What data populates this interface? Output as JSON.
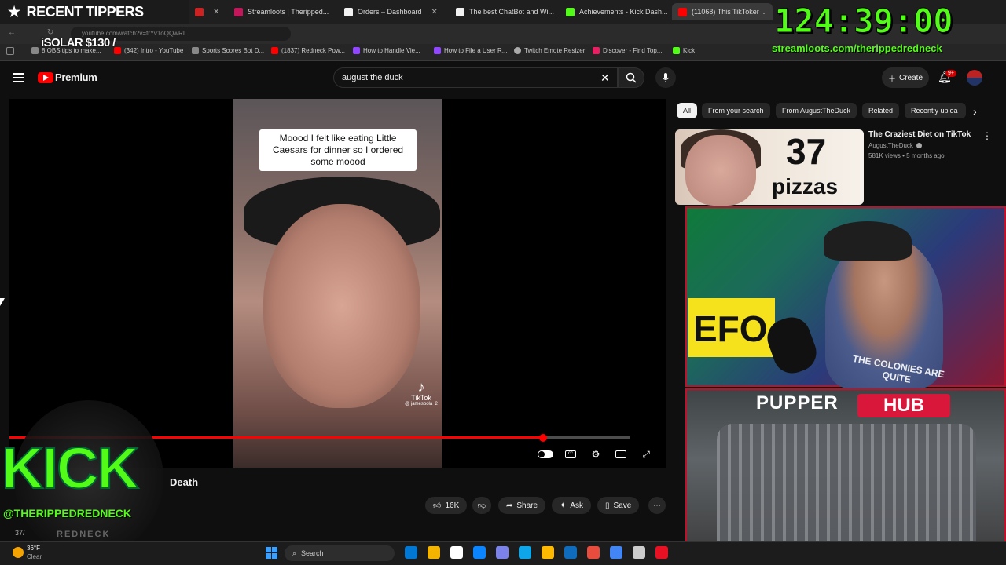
{
  "browser": {
    "tabs": [
      {
        "label": "",
        "color": "#cc2222"
      },
      {
        "label": "Streamloots | Theripped...",
        "color": "#c2185b"
      },
      {
        "label": "Orders – Dashboard",
        "color": "#f1f1f1"
      },
      {
        "label": "The best ChatBot and Wi...",
        "color": "#f1f1f1"
      },
      {
        "label": "Achievements - Kick Dash...",
        "color": "#53fc18"
      },
      {
        "label": "(11068) This TikToker ...",
        "color": "#ff0000"
      }
    ],
    "url": "youtube.com/watch?v=frYv1oQQwRI",
    "bookmarks": [
      {
        "label": "8 OBS tips to make...",
        "color": "#888888"
      },
      {
        "label": "(342) Intro - YouTube",
        "color": "#ff0000"
      },
      {
        "label": "Sports Scores Bot D...",
        "color": "#888888"
      },
      {
        "label": "(1837) Redneck Pow...",
        "color": "#ff0000"
      },
      {
        "label": "How to Handle Vie...",
        "color": "#9146ff"
      },
      {
        "label": "How to File a User R...",
        "color": "#9146ff"
      },
      {
        "label": "Twitch Emote Resizer",
        "color": "#aaaaaa"
      },
      {
        "label": "Discover - Find Top...",
        "color": "#e91e63"
      },
      {
        "label": "Kick",
        "color": "#53fc18"
      }
    ]
  },
  "youtube": {
    "logo": "Premium",
    "search_value": "august the duck",
    "create_label": "Create",
    "notif_count": "9+",
    "chips": [
      "All",
      "From your search",
      "From AugustTheDuck",
      "Related",
      "Recently uploa"
    ],
    "video": {
      "caption": "Moood I felt like eating Little Caesars for dinner so I ordered some moood",
      "watermark": "TikTok",
      "watermark_handle": "@ jamesbola_2",
      "progress": 0.86,
      "title_fragment": "Death",
      "views_fragment": "37/"
    },
    "actions": {
      "likes": "16K",
      "share": "Share",
      "ask": "Ask",
      "save": "Save"
    },
    "recommendation": {
      "thumb_number": "37",
      "thumb_word": "pizzas",
      "title": "The Craziest Diet on TikTok",
      "channel": "AugustTheDuck",
      "meta": "581K views • 5 months ago"
    }
  },
  "overlay": {
    "recent_tippers": "RECENT TIPPERS",
    "tipper_name": "iSOLAR $130 /",
    "timer": "124:39:00",
    "timer_url": "streamloots.com/therippedredneck",
    "webcam_sign": "EFO",
    "shirt_text": "THE COLONIES ARE QUITE",
    "pupper_label": "PUPPER",
    "hub_label": "HUB",
    "kick_text": "KICK",
    "kick_handle": "@THERIPPEDREDNECK",
    "kick_sub": "REDNECK"
  },
  "taskbar": {
    "temp": "36°F",
    "weather": "Clear",
    "search": "Search",
    "icon_colors": [
      "#0078d4",
      "#f4b400",
      "#ffffff",
      "#0b84ff",
      "#7b83eb",
      "#0ea5e9",
      "#ffb900",
      "#0f6cbd",
      "#e74c3c",
      "#4285f4",
      "#cccccc",
      "#e81123"
    ]
  }
}
